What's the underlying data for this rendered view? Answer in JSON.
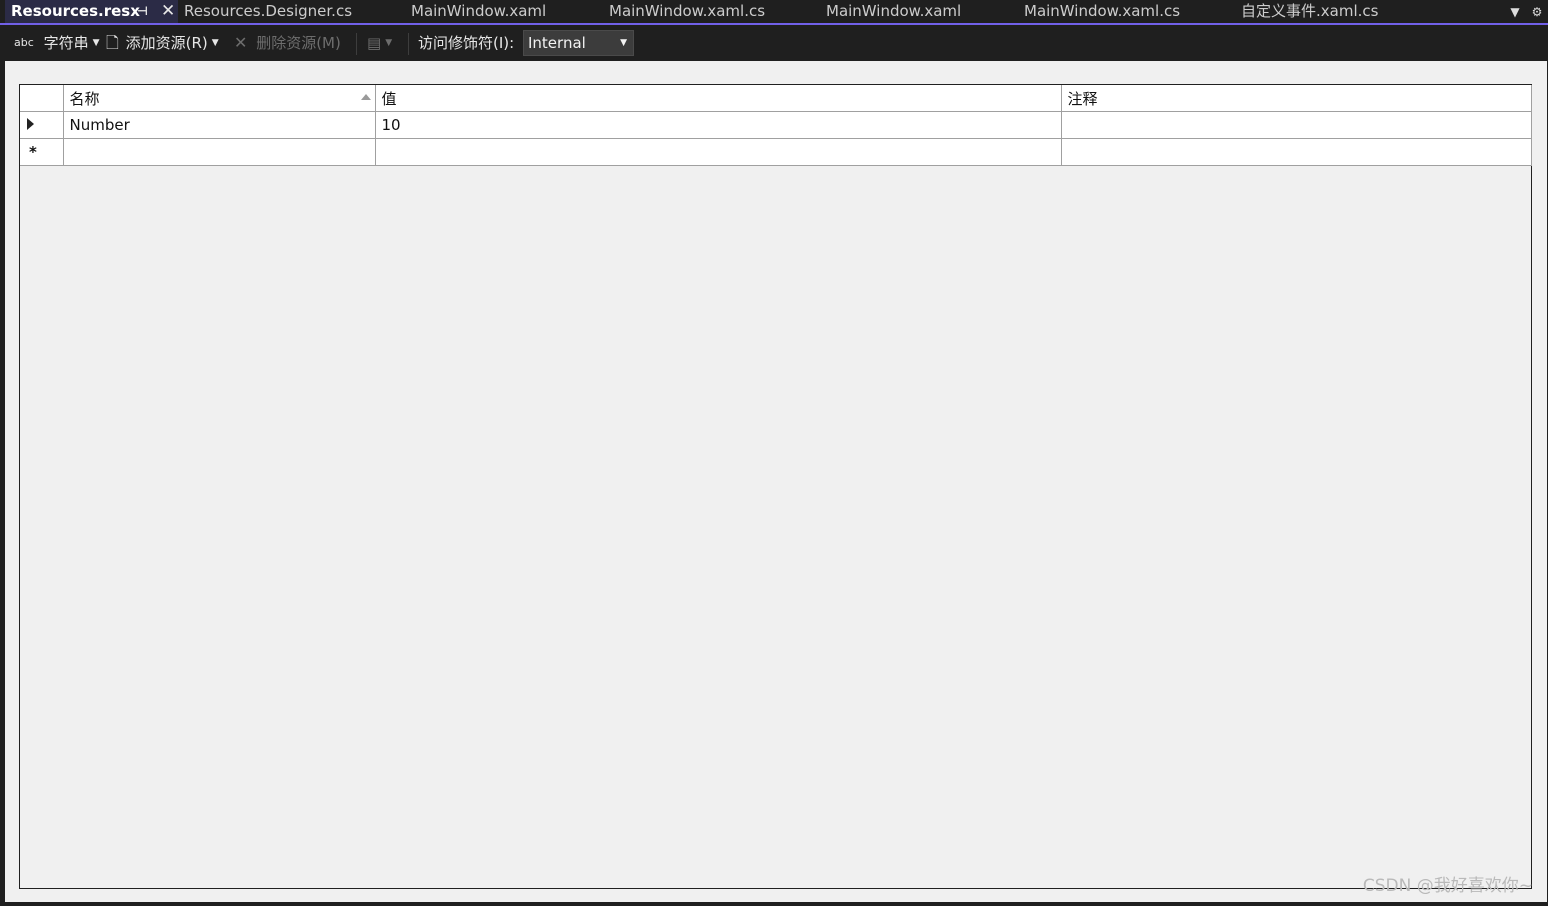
{
  "tabs": [
    {
      "label": "Resources.resx",
      "active": true
    },
    {
      "label": "Resources.Designer.cs",
      "active": false
    },
    {
      "label": "MainWindow.xaml",
      "active": false
    },
    {
      "label": "MainWindow.xaml.cs",
      "active": false
    },
    {
      "label": "MainWindow.xaml",
      "active": false
    },
    {
      "label": "MainWindow.xaml.cs",
      "active": false
    },
    {
      "label": "自定义事件.xaml.cs",
      "active": false
    }
  ],
  "toolbar": {
    "strings_label": "字符串",
    "strings_icon_text": "abc",
    "add_resource_label": "添加资源(R)",
    "remove_resource_label": "删除资源(M)",
    "access_modifier_label": "访问修饰符(I):",
    "access_modifier_value": "Internal"
  },
  "grid": {
    "columns": [
      "名称",
      "值",
      "注释"
    ],
    "rows": [
      {
        "name": "Number",
        "value": "10",
        "comment": ""
      }
    ],
    "new_row_marker": "*"
  },
  "watermark": "CSDN @我好喜欢你~"
}
